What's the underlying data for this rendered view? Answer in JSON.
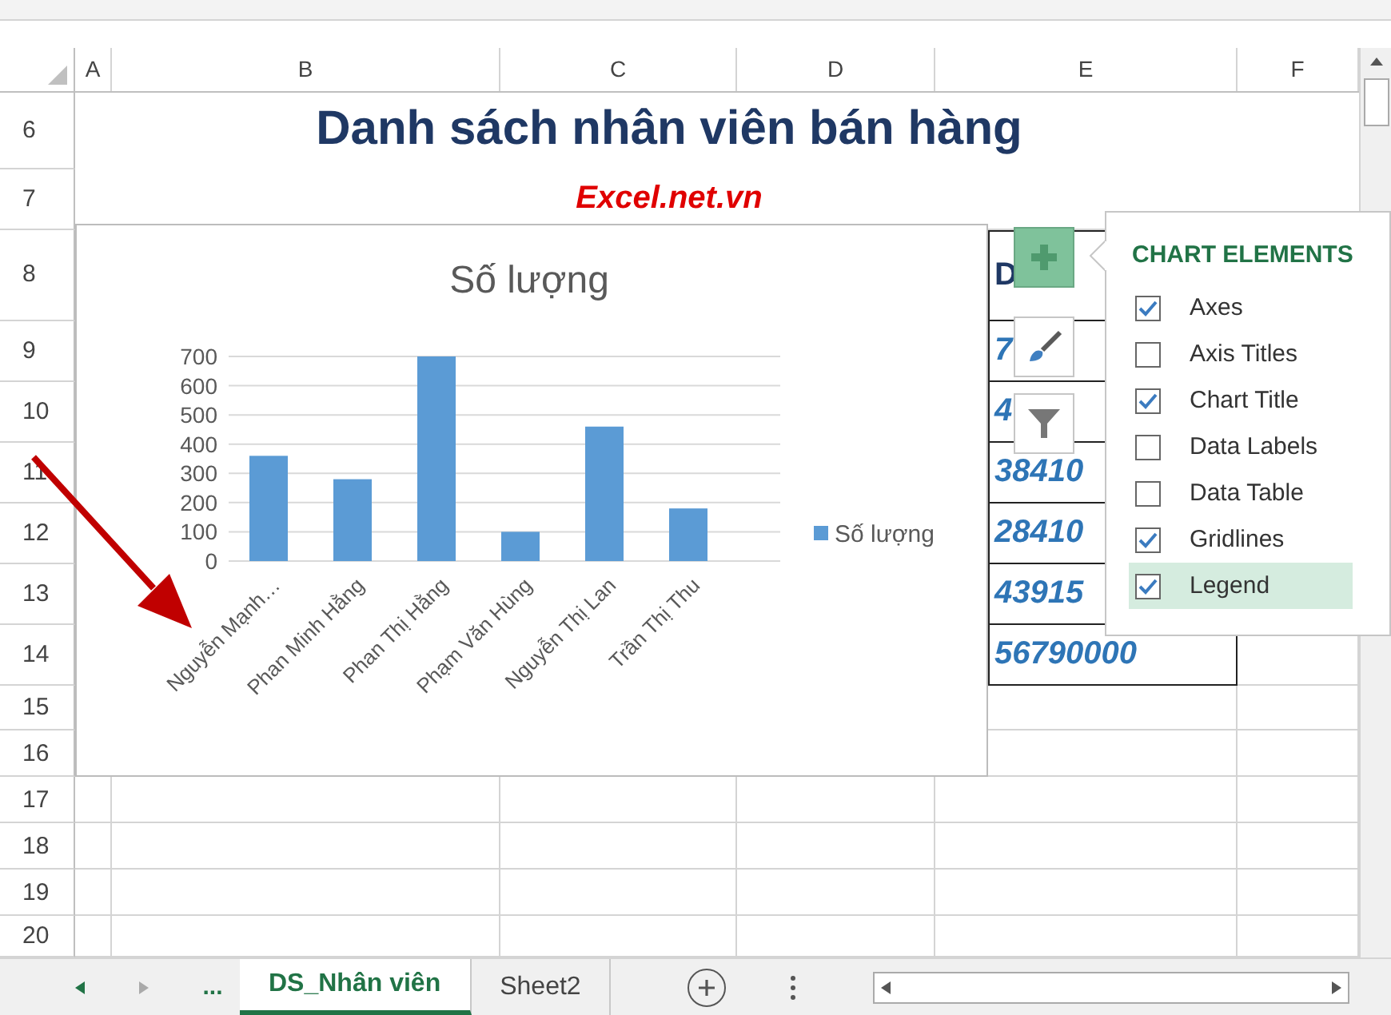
{
  "column_headers": [
    "A",
    "B",
    "C",
    "D",
    "E",
    "F"
  ],
  "rows": [
    {
      "number": "6"
    },
    {
      "number": "7"
    },
    {
      "number": "8",
      "column_e": "D"
    },
    {
      "number": "9",
      "column_e": "7"
    },
    {
      "number": "10",
      "column_e": "4"
    },
    {
      "number": "11",
      "column_e": "38410"
    },
    {
      "number": "12",
      "column_e": "28410"
    },
    {
      "number": "13",
      "column_e": "43915"
    },
    {
      "number": "14",
      "column_e": "56790000"
    },
    {
      "number": "15"
    },
    {
      "number": "16"
    },
    {
      "number": "17"
    },
    {
      "number": "18"
    },
    {
      "number": "19"
    },
    {
      "number": "20"
    }
  ],
  "title": "Danh sách nhân viên bán hàng",
  "subtitle": "Excel.net.vn",
  "chart": {
    "chart_data": {
      "type": "bar",
      "title": "Số lượng",
      "categories": [
        "Nguyễn  Mạnh…",
        "Phan  Minh Hằng",
        "Phan  Thị Hằng",
        "Phạm  Văn Hùng",
        "Nguyễn  Thị Lan",
        "Trần  Thị Thu"
      ],
      "series": [
        {
          "name": "Số lượng",
          "color": "#5b9bd5",
          "values": [
            360,
            280,
            700,
            100,
            460,
            180
          ]
        }
      ],
      "ylim": [
        0,
        700
      ],
      "grid": true,
      "yticks": [
        0,
        100,
        200,
        300,
        400,
        500,
        600,
        700
      ]
    }
  },
  "chart_elements": {
    "title": "CHART ELEMENTS",
    "items": [
      {
        "label": "Axes",
        "checked": true,
        "selected": false
      },
      {
        "label": "Axis Titles",
        "checked": false,
        "selected": false
      },
      {
        "label": "Chart Title",
        "checked": true,
        "selected": false
      },
      {
        "label": "Data Labels",
        "checked": false,
        "selected": false
      },
      {
        "label": "Data Table",
        "checked": false,
        "selected": false
      },
      {
        "label": "Gridlines",
        "checked": true,
        "selected": false
      },
      {
        "label": "Legend",
        "checked": true,
        "selected": true
      }
    ]
  },
  "sheet_tabs": {
    "more": "...",
    "tabs": [
      {
        "label": "DS_Nhân viên",
        "selected": true
      },
      {
        "label": "Sheet2",
        "selected": false
      }
    ]
  }
}
